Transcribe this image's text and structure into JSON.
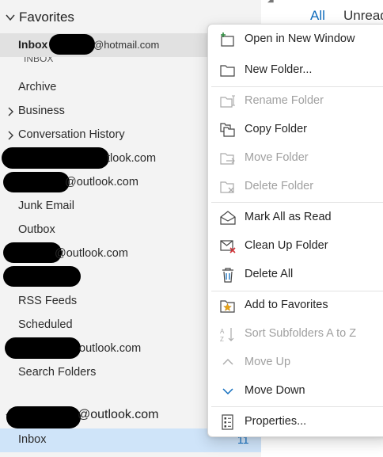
{
  "favorites": {
    "header_label": "Favorites",
    "inbox_label": "Inbox",
    "inbox_account_suffix": "@hotmail.com",
    "sub_folder_label": "INBOX"
  },
  "folders": [
    {
      "label": "Archive"
    },
    {
      "label": "Business"
    },
    {
      "label": "Conversation History"
    },
    {
      "label": "tlook.com"
    },
    {
      "label": "@outlook.com"
    },
    {
      "label": "Junk Email"
    },
    {
      "label": "Outbox"
    },
    {
      "label": "@outlook.com"
    },
    {
      "label": ""
    },
    {
      "label": "RSS Feeds"
    },
    {
      "label": "Scheduled"
    },
    {
      "label": "outlook.com"
    },
    {
      "label": "Search Folders"
    }
  ],
  "account": {
    "label": "@outlook.com"
  },
  "bottom_inbox": {
    "label": "Inbox",
    "count": "11"
  },
  "message_list": {
    "tab_all": "All",
    "tab_unread": "Unread"
  },
  "context_menu": [
    {
      "label": "Open in New Window",
      "icon": "open-new-window-icon",
      "enabled": true
    },
    {
      "label": "New Folder...",
      "icon": "new-folder-icon",
      "enabled": true
    },
    {
      "label": "Rename Folder",
      "icon": "rename-folder-icon",
      "enabled": false
    },
    {
      "label": "Copy Folder",
      "icon": "copy-folder-icon",
      "enabled": true
    },
    {
      "label": "Move Folder",
      "icon": "move-folder-icon",
      "enabled": false
    },
    {
      "label": "Delete Folder",
      "icon": "delete-folder-icon",
      "enabled": false
    },
    {
      "label": "Mark All as Read",
      "icon": "mark-read-icon",
      "enabled": true
    },
    {
      "label": "Clean Up Folder",
      "icon": "clean-up-folder-icon",
      "enabled": true
    },
    {
      "label": "Delete All",
      "icon": "delete-all-icon",
      "enabled": true
    },
    {
      "label": "Add to Favorites",
      "icon": "favorite-star-icon",
      "enabled": true
    },
    {
      "label": "Sort Subfolders A to Z",
      "icon": "sort-a-z-icon",
      "enabled": false
    },
    {
      "label": "Move Up",
      "icon": "chevron-up-icon",
      "enabled": false
    },
    {
      "label": "Move Down",
      "icon": "chevron-down-icon",
      "enabled": true
    },
    {
      "label": "Properties...",
      "icon": "properties-icon",
      "enabled": true
    }
  ],
  "colors": {
    "accent": "#0f6cbd",
    "selected_bg": "#cfe4f9",
    "pane_bg": "#f3f3f3"
  }
}
